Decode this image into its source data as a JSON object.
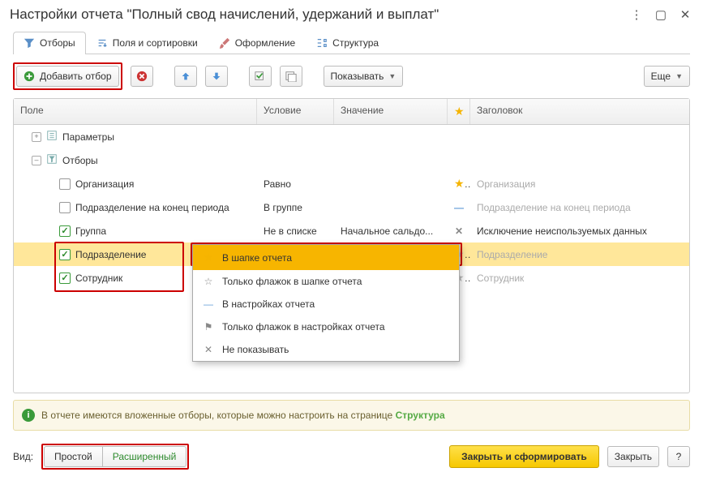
{
  "window": {
    "title": "Настройки отчета \"Полный свод начислений, удержаний и выплат\""
  },
  "tabs": {
    "filters": "Отборы",
    "sort": "Поля и сортировки",
    "format": "Оформление",
    "structure": "Структура"
  },
  "toolbar": {
    "add_filter": "Добавить отбор",
    "show": "Показывать",
    "more": "Еще"
  },
  "columns": {
    "field": "Поле",
    "condition": "Условие",
    "value": "Значение",
    "title": "Заголовок"
  },
  "tree": {
    "params": "Параметры",
    "filters": "Отборы",
    "rows": [
      {
        "label": "Организация",
        "cond": "Равно",
        "val": "",
        "star": "star",
        "title": "Организация",
        "title_ph": true,
        "checked": false
      },
      {
        "label": "Подразделение на конец периода",
        "cond": "В группе",
        "val": "",
        "star": "dash",
        "title": "Подразделение на конец периода",
        "title_ph": true,
        "checked": false
      },
      {
        "label": "Группа",
        "cond": "Не в списке",
        "val": "Начальное сальдо...",
        "star": "x",
        "title": "Исключение неиспользуемых данных",
        "title_ph": false,
        "checked": true
      },
      {
        "label": "Подразделение",
        "cond": "",
        "val": "",
        "star": "star-gray",
        "title": "Подразделение",
        "title_ph": true,
        "checked": true,
        "selected": true
      },
      {
        "label": "Сотрудник",
        "cond": "",
        "val": "",
        "star": "star-gray",
        "title": "Сотрудник",
        "title_ph": true,
        "checked": true
      }
    ]
  },
  "dropdown": {
    "items": [
      "В шапке отчета",
      "Только флажок в шапке отчета",
      "В настройках отчета",
      "Только флажок в настройках отчета",
      "Не показывать"
    ]
  },
  "info": {
    "text": "В отчете имеются вложенные отборы, которые можно настроить на странице ",
    "link": "Структура"
  },
  "footer": {
    "view": "Вид:",
    "simple": "Простой",
    "advanced": "Расширенный",
    "primary": "Закрыть и сформировать",
    "close": "Закрыть",
    "help": "?"
  }
}
